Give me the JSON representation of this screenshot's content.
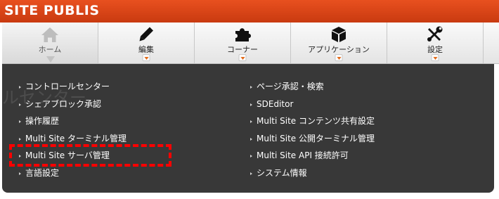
{
  "brand": {
    "title": "SITE PUBLIS"
  },
  "nav": [
    {
      "label": "ホーム",
      "icon": "home-icon",
      "active": true
    },
    {
      "label": "編集",
      "icon": "pencil-icon"
    },
    {
      "label": "コーナー",
      "icon": "puzzle-icon"
    },
    {
      "label": "アプリケーション",
      "icon": "cube-icon"
    },
    {
      "label": "設定",
      "icon": "tools-icon"
    }
  ],
  "background_text": "ルセンター",
  "menu": {
    "left": [
      "コントロールセンター",
      "シェアブロック承認",
      "操作履歴",
      "Multi Site ターミナル管理",
      "Multi Site サーバ管理",
      "言語設定"
    ],
    "right": [
      "ページ承認・検索",
      "SDEditor",
      "Multi Site コンテンツ共有設定",
      "Multi Site 公開ターミナル管理",
      "Multi Site API 接続許可",
      "システム情報"
    ]
  },
  "colors": {
    "brand_bar": "#d84a1b",
    "dropdown_bg": "#383838",
    "highlight": "#ff0000",
    "caret": "#e36a18"
  }
}
